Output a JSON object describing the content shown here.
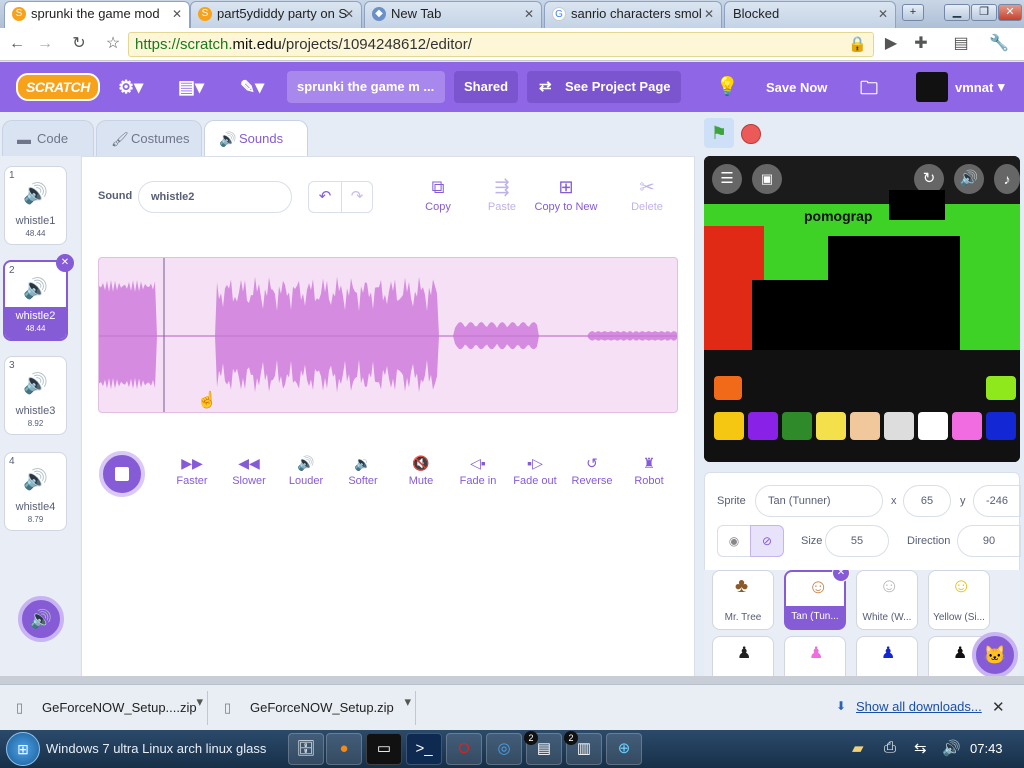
{
  "browser": {
    "tabs": [
      {
        "title": "sprunki the game mod",
        "active": true
      },
      {
        "title": "part5ydiddy party on S",
        "active": false
      },
      {
        "title": "New Tab",
        "active": false
      },
      {
        "title": "sanrio characters smol",
        "active": false
      },
      {
        "title": "Blocked",
        "active": false
      }
    ],
    "url_scheme": "https://scratch.",
    "url_host": "mit.edu",
    "url_path": "/projects/1094248612/editor/"
  },
  "menubar": {
    "logo": "SCRATCH",
    "project_title": "sprunki the game m ...",
    "shared_label": "Shared",
    "see_project_label": "See Project Page",
    "save_label": "Save Now",
    "username": "vmnat",
    "colors": {
      "bar": "#8e66e6",
      "accent": "#855cd6"
    }
  },
  "editor_tabs": [
    {
      "label": "Code",
      "icon": "code-icon"
    },
    {
      "label": "Costumes",
      "icon": "brush-icon"
    },
    {
      "label": "Sounds",
      "icon": "speaker-icon",
      "active": true
    }
  ],
  "sounds": [
    {
      "num": "1",
      "name": "whistle1",
      "duration": "48.44"
    },
    {
      "num": "2",
      "name": "whistle2",
      "duration": "48.44",
      "selected": true
    },
    {
      "num": "3",
      "name": "whistle3",
      "duration": "8.92"
    },
    {
      "num": "4",
      "name": "whistle4",
      "duration": "8.79"
    }
  ],
  "sound_editor": {
    "sound_label": "Sound",
    "sound_name": "whistle2",
    "tools": [
      "Copy",
      "Paste",
      "Copy to New",
      "Delete"
    ],
    "effects": [
      "Faster",
      "Slower",
      "Louder",
      "Softer",
      "Mute",
      "Fade in",
      "Fade out",
      "Reverse",
      "Robot"
    ],
    "waveform_color": "#d58be0"
  },
  "stage": {
    "overlay_text": "pomograp"
  },
  "sprite_info": {
    "sprite_label": "Sprite",
    "sprite_name": "Tan (Tunner)",
    "x_label": "x",
    "x_value": "65",
    "y_label": "y",
    "y_value": "-246",
    "size_label": "Size",
    "size_value": "55",
    "direction_label": "Direction",
    "direction_value": "90"
  },
  "sprites": [
    {
      "name": "Mr. Tree"
    },
    {
      "name": "Tan (Tun...",
      "selected": true
    },
    {
      "name": "White (W..."
    },
    {
      "name": "Yellow (Si..."
    }
  ],
  "downloads": {
    "items": [
      "GeForceNOW_Setup....zip",
      "GeForceNOW_Setup.zip"
    ],
    "show_all": "Show all downloads..."
  },
  "taskbar": {
    "start_text": "Windows 7 ultra Linux arch linux glass",
    "time": "07:43",
    "badges": [
      "2",
      "2"
    ]
  }
}
